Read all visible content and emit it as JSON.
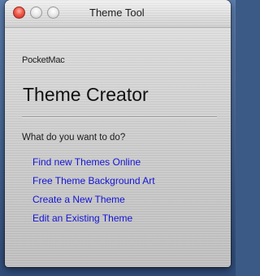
{
  "window": {
    "title": "Theme Tool",
    "controls": {
      "close": "close-icon",
      "minimize": "minimize-icon",
      "zoom": "zoom-icon"
    }
  },
  "main": {
    "vendor": "PocketMac",
    "app_title": "Theme Creator",
    "prompt": "What do you want to do?",
    "actions": [
      {
        "label": "Find new Themes Online"
      },
      {
        "label": "Free Theme Background Art"
      },
      {
        "label": "Create a New Theme"
      },
      {
        "label": "Edit an Existing Theme"
      }
    ]
  },
  "colors": {
    "link": "#1414d8",
    "close_button": "#f05b4a"
  }
}
